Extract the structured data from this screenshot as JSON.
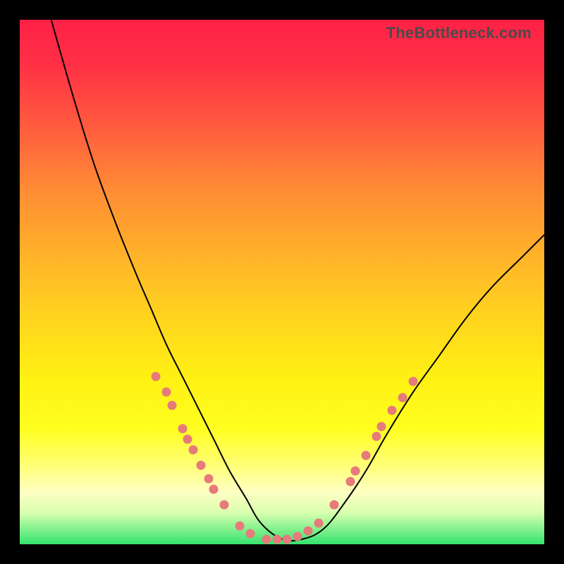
{
  "watermark": "TheBottleneck.com",
  "colors": {
    "frame_bg": "#000000",
    "curve_stroke": "#000000",
    "dot_fill": "#e77a7a"
  },
  "chart_data": {
    "type": "line",
    "title": "",
    "xlabel": "",
    "ylabel": "",
    "xlim": [
      0,
      100
    ],
    "ylim": [
      0,
      100
    ],
    "grid": false,
    "series": [
      {
        "name": "curve",
        "x": [
          6,
          10,
          14,
          18,
          22,
          25,
          28,
          31,
          34,
          37,
          40,
          43,
          46,
          50,
          54,
          58,
          62,
          66,
          70,
          75,
          80,
          85,
          90,
          96,
          100
        ],
        "values": [
          100,
          86,
          73,
          62,
          52,
          45,
          38,
          32,
          26,
          20,
          14,
          9,
          4,
          1,
          1,
          3,
          8,
          14,
          21,
          29,
          36,
          43,
          49,
          55,
          59
        ]
      }
    ],
    "markers": [
      {
        "x": 26,
        "y": 32
      },
      {
        "x": 28,
        "y": 29
      },
      {
        "x": 29,
        "y": 26.5
      },
      {
        "x": 31,
        "y": 22
      },
      {
        "x": 32,
        "y": 20
      },
      {
        "x": 33,
        "y": 18
      },
      {
        "x": 34.5,
        "y": 15
      },
      {
        "x": 36,
        "y": 12.5
      },
      {
        "x": 37,
        "y": 10.5
      },
      {
        "x": 39,
        "y": 7.5
      },
      {
        "x": 42,
        "y": 3.5
      },
      {
        "x": 44,
        "y": 2
      },
      {
        "x": 47,
        "y": 1
      },
      {
        "x": 49,
        "y": 1
      },
      {
        "x": 51,
        "y": 1
      },
      {
        "x": 53,
        "y": 1.5
      },
      {
        "x": 55,
        "y": 2.5
      },
      {
        "x": 57,
        "y": 4
      },
      {
        "x": 60,
        "y": 7.5
      },
      {
        "x": 63,
        "y": 12
      },
      {
        "x": 64,
        "y": 14
      },
      {
        "x": 66,
        "y": 17
      },
      {
        "x": 68,
        "y": 20.5
      },
      {
        "x": 69,
        "y": 22.5
      },
      {
        "x": 71,
        "y": 25.5
      },
      {
        "x": 73,
        "y": 28
      },
      {
        "x": 75,
        "y": 31
      }
    ]
  }
}
